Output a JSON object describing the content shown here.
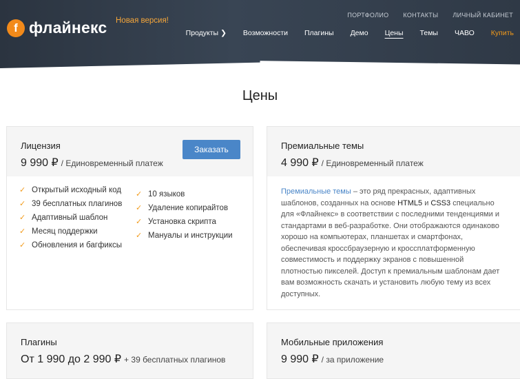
{
  "header": {
    "logo_letter": "f",
    "logo_text": "флайнекс",
    "new_version": "Новая версия!",
    "top_links": [
      "ПОРТФОЛИО",
      "КОНТАКТЫ",
      "ЛИЧНЫЙ КАБИНЕТ"
    ],
    "nav": [
      "Продукты",
      "Возможности",
      "Плагины",
      "Демо",
      "Цены",
      "Темы",
      "ЧАВО",
      "Купить"
    ],
    "active_nav": "Цены",
    "accent_color": "#f29a1a"
  },
  "page_title": "Цены",
  "license": {
    "title": "Лицензия",
    "price": "9 990 ₽",
    "price_note": "/ Единовременный платеж",
    "order_button": "Заказать",
    "features_left": [
      "Открытый исходный код",
      "39 бесплатных плагинов",
      "Адаптивный шаблон",
      "Месяц поддержки",
      "Обновления и багфиксы"
    ],
    "features_right": [
      "10 языков",
      "Удаление копирайтов",
      "Установка скрипта",
      "Мануалы и инструкции"
    ]
  },
  "premium": {
    "title": "Премиальные темы",
    "price": "4 990 ₽",
    "price_note": "/ Единовременный платеж",
    "desc_link": "Премиальные темы",
    "desc_1": " – это ряд прекрасных, адаптивных шаблонов, созданных на основе ",
    "desc_html5": "HTML5",
    "desc_and": " и ",
    "desc_css3": "CSS3",
    "desc_2": " специально для «Флайнекс» в соответствии с последними тенденциями и стандартами в веб-разработке. Они отображаются одинаково хорошо на компьютерах, планшетах и смартфонах, обеспечивая кроссбраузерную и кроссплатформенную совместимость и поддержку экранов с повышенной плотностью пикселей. Доступ к премиальным шаблонам дает вам возможность скачать и установить любую тему из всех доступных."
  },
  "plugins": {
    "title": "Плагины",
    "price": "От 1 990 до 2 990 ₽",
    "price_note": "+ 39 бесплатных плагинов"
  },
  "mobile": {
    "title": "Мобильные приложения",
    "price": "9 990 ₽",
    "price_note": "/ за приложение"
  }
}
